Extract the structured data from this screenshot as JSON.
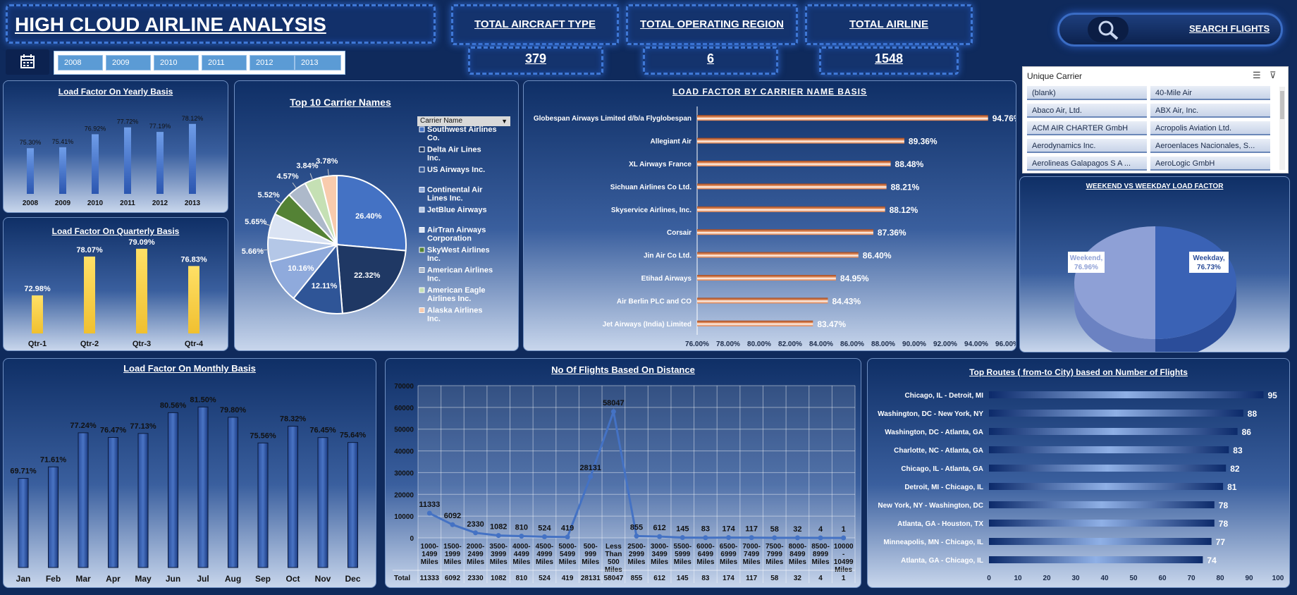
{
  "header": {
    "title": "HIGH CLOUD AIRLINE ANALYSIS",
    "search_label": "SEARCH FLIGHTS"
  },
  "kpis": [
    {
      "title": "TOTAL AIRCRAFT TYPE",
      "value": "379"
    },
    {
      "title": "TOTAL OPERATING REGION",
      "value": "6"
    },
    {
      "title": "TOTAL AIRLINE",
      "value": "1548"
    }
  ],
  "years": [
    "2008",
    "2009",
    "2010",
    "2011",
    "2012",
    "2013"
  ],
  "yearly": {
    "title": "Load Factor On Yearly Basis",
    "chart_data": {
      "type": "bar",
      "categories": [
        "2008",
        "2009",
        "2010",
        "2011",
        "2012",
        "2013"
      ],
      "values": [
        75.3,
        75.41,
        76.92,
        77.72,
        77.19,
        78.12
      ],
      "labels": [
        "75.30%",
        "75.41%",
        "76.92%",
        "77.72%",
        "77.19%",
        "78.12%"
      ]
    }
  },
  "quarterly": {
    "title": "Load Factor On Quarterly Basis",
    "chart_data": {
      "type": "bar",
      "categories": [
        "Qtr-1",
        "Qtr-2",
        "Qtr-3",
        "Qtr-4"
      ],
      "values": [
        72.98,
        78.07,
        79.09,
        76.83
      ],
      "labels": [
        "72.98%",
        "78.07%",
        "79.09%",
        "76.83%"
      ]
    }
  },
  "top10": {
    "title": "Top 10 Carrier Names",
    "filter_label": "Carrier Name",
    "chart_data": {
      "type": "pie",
      "categories": [
        "Southwest Airlines Co.",
        "Delta Air Lines Inc.",
        "US Airways Inc.",
        "Continental Air Lines Inc.",
        "JetBlue Airways",
        "AirTran Airways Corporation",
        "SkyWest Airlines Inc.",
        "American Airlines Inc.",
        "American Eagle Airlines Inc.",
        "Alaska Airlines Inc."
      ],
      "values": [
        26.4,
        22.32,
        12.11,
        10.16,
        5.66,
        5.65,
        5.52,
        4.57,
        3.84,
        3.78
      ],
      "labels": [
        "26.40%",
        "22.32%",
        "12.11%",
        "10.16%",
        "5.66%",
        "5.65%",
        "5.52%",
        "4.57%",
        "3.84%",
        "3.78%"
      ]
    },
    "colors": [
      "#4472c4",
      "#1f3864",
      "#2f5597",
      "#8faadc",
      "#b4c7e7",
      "#dae3f3",
      "#548235",
      "#adb9ca",
      "#c5e0b4",
      "#f8cbad"
    ]
  },
  "carrier_lf": {
    "title": "LOAD FACTOR BY CARRIER NAME BASIS",
    "chart_data": {
      "type": "bar",
      "categories": [
        "Globespan Airways Limited d/b/a Flyglobespan",
        "Allegiant Air",
        "XL Airways France",
        "Sichuan Airlines Co Ltd.",
        "Skyservice Airlines, Inc.",
        "Corsair",
        "Jin Air Co Ltd.",
        "Etihad Airways",
        "Air Berlin PLC and CO",
        "Jet Airways (India) Limited"
      ],
      "values": [
        94.76,
        89.36,
        88.48,
        88.21,
        88.12,
        87.36,
        86.4,
        84.95,
        84.43,
        83.47
      ],
      "labels": [
        "94.76%",
        "89.36%",
        "88.48%",
        "88.21%",
        "88.12%",
        "87.36%",
        "86.40%",
        "84.95%",
        "84.43%",
        "83.47%"
      ],
      "xlim": [
        76,
        96
      ],
      "ticks": [
        "76.00%",
        "78.00%",
        "80.00%",
        "82.00%",
        "84.00%",
        "86.00%",
        "88.00%",
        "90.00%",
        "92.00%",
        "94.00%",
        "96.00%"
      ]
    }
  },
  "slicer": {
    "title": "Unique Carrier",
    "items": [
      "(blank)",
      "40-Mile Air",
      "Abaco Air, Ltd.",
      "ABX Air, Inc.",
      "ACM AIR CHARTER GmbH",
      "Acropolis Aviation Ltd.",
      "Aerodynamics Inc.",
      "Aeroenlaces Nacionales, S...",
      "Aerolineas Galapagos S A ...",
      "AeroLogic GmbH"
    ]
  },
  "weekend": {
    "title": "WEEKEND VS WEEKDAY LOAD FACTOR",
    "chart_data": {
      "type": "pie",
      "categories": [
        "Weekend",
        "Weekday"
      ],
      "values": [
        76.96,
        76.73
      ],
      "labels": [
        "Weekend,\n76.96%",
        "Weekday,\n76.73%"
      ]
    },
    "label_weekend_1": "Weekend,",
    "label_weekend_2": "76.96%",
    "label_weekday_1": "Weekday,",
    "label_weekday_2": "76.73%"
  },
  "monthly": {
    "title": "Load Factor On Monthly Basis",
    "chart_data": {
      "type": "bar",
      "categories": [
        "Jan",
        "Feb",
        "Mar",
        "Apr",
        "May",
        "Jun",
        "Jul",
        "Aug",
        "Sep",
        "Oct",
        "Nov",
        "Dec"
      ],
      "values": [
        69.71,
        71.61,
        77.24,
        76.47,
        77.13,
        80.56,
        81.5,
        79.8,
        75.56,
        78.32,
        76.45,
        75.64
      ],
      "labels": [
        "69.71%",
        "71.61%",
        "77.24%",
        "76.47%",
        "77.13%",
        "80.56%",
        "81.50%",
        "79.80%",
        "75.56%",
        "78.32%",
        "76.45%",
        "75.64%"
      ]
    }
  },
  "distance": {
    "title": "No Of Flights Based On Distance",
    "total_label": "Total",
    "chart_data": {
      "type": "line",
      "categories": [
        "1000-1499 Miles",
        "1500-1999 Miles",
        "2000-2499 Miles",
        "3500-3999 Miles",
        "4000-4499 Miles",
        "4500-4999 Miles",
        "5000-5499 Miles",
        "500-999 Miles",
        "Less Than 500 Miles",
        "2500-2999 Miles",
        "3000-3499 Miles",
        "5500-5999 Miles",
        "6000-6499 Miles",
        "6500-6999 Miles",
        "7000-7499 Miles",
        "7500-7999 Miles",
        "8000-8499 Miles",
        "8500-8999 Miles",
        "10000-10499 Miles"
      ],
      "cat_lines": [
        [
          "1000-",
          "1499",
          "Miles"
        ],
        [
          "1500-",
          "1999",
          "Miles"
        ],
        [
          "2000-",
          "2499",
          "Miles"
        ],
        [
          "3500-",
          "3999",
          "Miles"
        ],
        [
          "4000-",
          "4499",
          "Miles"
        ],
        [
          "4500-",
          "4999",
          "Miles"
        ],
        [
          "5000-",
          "5499",
          "Miles"
        ],
        [
          "500-",
          "999",
          "Miles"
        ],
        [
          "Less",
          "Than",
          "500",
          "Miles"
        ],
        [
          "2500-",
          "2999",
          "Miles"
        ],
        [
          "3000-",
          "3499",
          "Miles"
        ],
        [
          "5500-",
          "5999",
          "Miles"
        ],
        [
          "6000-",
          "6499",
          "Miles"
        ],
        [
          "6500-",
          "6999",
          "Miles"
        ],
        [
          "7000-",
          "7499",
          "Miles"
        ],
        [
          "7500-",
          "7999",
          "Miles"
        ],
        [
          "8000-",
          "8499",
          "Miles"
        ],
        [
          "8500-",
          "8999",
          "Miles"
        ],
        [
          "10000",
          "-",
          "10499",
          "Miles"
        ]
      ],
      "values": [
        11333,
        6092,
        2330,
        1082,
        810,
        524,
        419,
        28131,
        58047,
        855,
        612,
        145,
        83,
        174,
        117,
        58,
        32,
        4,
        1
      ],
      "ylim": [
        0,
        70000
      ],
      "yticks": [
        "0",
        "10000",
        "20000",
        "30000",
        "40000",
        "50000",
        "60000",
        "70000"
      ]
    }
  },
  "routes": {
    "title": "Top Routes ( from-to City) based on Number of Flights",
    "chart_data": {
      "type": "bar",
      "categories": [
        "Chicago, IL - Detroit, MI",
        "Washington, DC - New York, NY",
        "Washington, DC - Atlanta, GA",
        "Charlotte, NC - Atlanta, GA",
        "Chicago, IL - Atlanta, GA",
        "Detroit, MI - Chicago, IL",
        "New York, NY - Washington, DC",
        "Atlanta, GA - Houston, TX",
        "Minneapolis, MN - Chicago, IL",
        "Atlanta, GA - Chicago, IL"
      ],
      "values": [
        95,
        88,
        86,
        83,
        82,
        81,
        78,
        78,
        77,
        74
      ],
      "xlim": [
        0,
        100
      ],
      "ticks": [
        "0",
        "10",
        "20",
        "30",
        "40",
        "50",
        "60",
        "70",
        "80",
        "90",
        "100"
      ]
    }
  }
}
